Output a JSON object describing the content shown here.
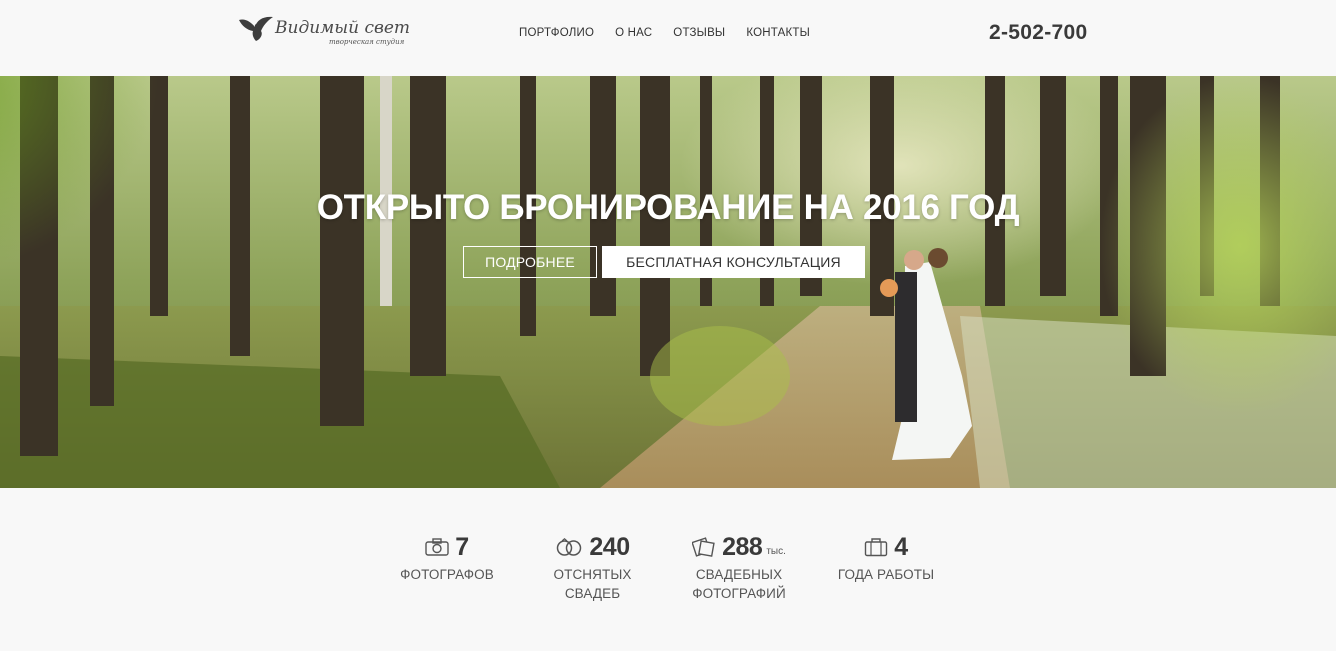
{
  "header": {
    "logo_title": "Видимый свет",
    "logo_subtitle": "творческая студия",
    "nav": [
      "ПОРТФОЛИО",
      "О НАС",
      "ОТЗЫВЫ",
      "КОНТАКТЫ"
    ],
    "phone": "2-502-700"
  },
  "hero": {
    "title": "ОТКРЫТО БРОНИРОВАНИЕ НА 2016 ГОД",
    "button_more": "ПОДРОБНЕЕ",
    "button_consult": "БЕСПЛАТНАЯ КОНСУЛЬТАЦИЯ"
  },
  "stats": [
    {
      "icon": "camera-icon",
      "value": "7",
      "unit": "",
      "label": "ФОТОГРАФОВ"
    },
    {
      "icon": "rings-icon",
      "value": "240",
      "unit": "",
      "label": "ОТСНЯТЫХ\nСВАДЕБ"
    },
    {
      "icon": "photos-icon",
      "value": "288",
      "unit": "тыс.",
      "label": "СВАДЕБНЫХ\nФОТОГРАФИЙ"
    },
    {
      "icon": "briefcase-icon",
      "value": "4",
      "unit": "",
      "label": "ГОДА РАБОТЫ"
    }
  ],
  "colors": {
    "page_bg": "#f8f8f8",
    "text_dark": "#3a3a3a",
    "hero_text": "#ffffff"
  }
}
